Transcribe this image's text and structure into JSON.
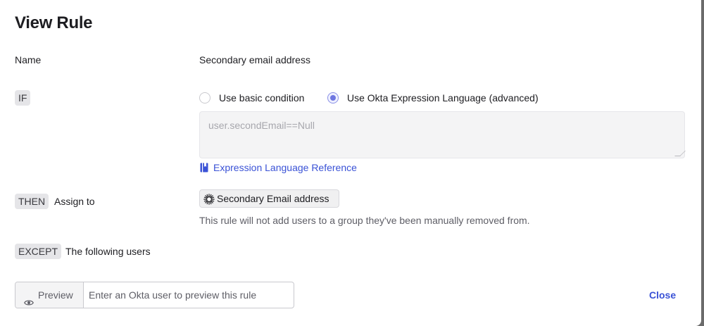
{
  "dialog": {
    "title": "View Rule",
    "name_label": "Name",
    "name_value": "Secondary email address"
  },
  "if_section": {
    "tag": "IF",
    "radio_basic_label": "Use basic condition",
    "radio_advanced_label": "Use Okta Expression Language (advanced)",
    "selected": "advanced",
    "expression_placeholder": "user.secondEmail==Null",
    "reference_link": "Expression Language Reference"
  },
  "then_section": {
    "tag": "THEN",
    "label": "Assign to",
    "group_chip": "Secondary Email address",
    "note": "This rule will not add users to a group they've been manually removed from."
  },
  "except_section": {
    "tag": "EXCEPT",
    "label": "The following users"
  },
  "footer": {
    "preview_button": "Preview",
    "preview_placeholder": "Enter an Okta user to preview this rule",
    "close_button": "Close"
  },
  "colors": {
    "accent_link": "#3a52d6",
    "radio_selected": "#6e76e0"
  }
}
